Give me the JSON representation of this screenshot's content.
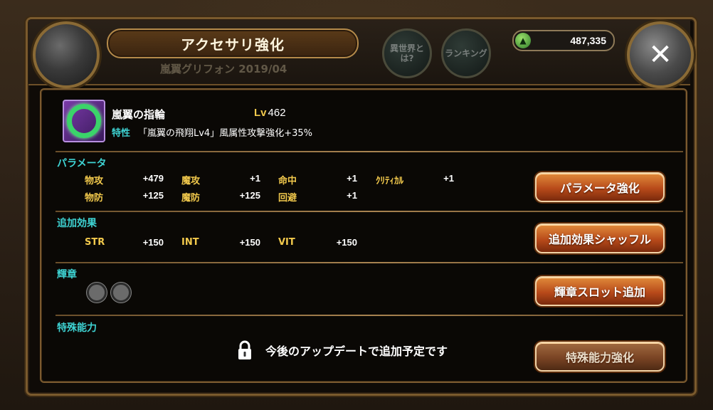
{
  "header": {
    "title": "アクセサリ強化",
    "subtitle": "嵐翼グリフォン 2019/04",
    "btn_other_world": "異世界とは?",
    "btn_ranking": "ランキング",
    "gold": "487,335"
  },
  "item": {
    "name": "嵐翼の指輪",
    "lv_label": "Lv",
    "lv_value": "462",
    "trait_label": "特性",
    "trait_text": "「嵐翼の飛翔Lv4」風属性攻撃強化+35%"
  },
  "sections": {
    "params_title": "パラメータ",
    "bonus_title": "追加効果",
    "emblem_title": "輝章",
    "special_title": "特殊能力"
  },
  "params": [
    {
      "label": "物攻",
      "value": "+479"
    },
    {
      "label": "魔攻",
      "value": "+1"
    },
    {
      "label": "命中",
      "value": "+1"
    },
    {
      "label": "ｸﾘﾃｨｶﾙ",
      "value": "+1"
    },
    {
      "label": "物防",
      "value": "+125"
    },
    {
      "label": "魔防",
      "value": "+125"
    },
    {
      "label": "回避",
      "value": "+1"
    }
  ],
  "bonus": [
    {
      "label": "STR",
      "value": "+150"
    },
    {
      "label": "INT",
      "value": "+150"
    },
    {
      "label": "VIT",
      "value": "+150"
    }
  ],
  "buttons": {
    "param_up": "パラメータ強化",
    "bonus_shuffle": "追加効果シャッフル",
    "emblem_slot": "輝章スロット追加",
    "special_up": "特殊能力強化"
  },
  "locked_message": "今後のアップデートで追加予定です",
  "colors": {
    "accent_cyan": "#3ed3d3",
    "label_gold": "#f2c94c",
    "button_orange": "#b84a1a"
  }
}
